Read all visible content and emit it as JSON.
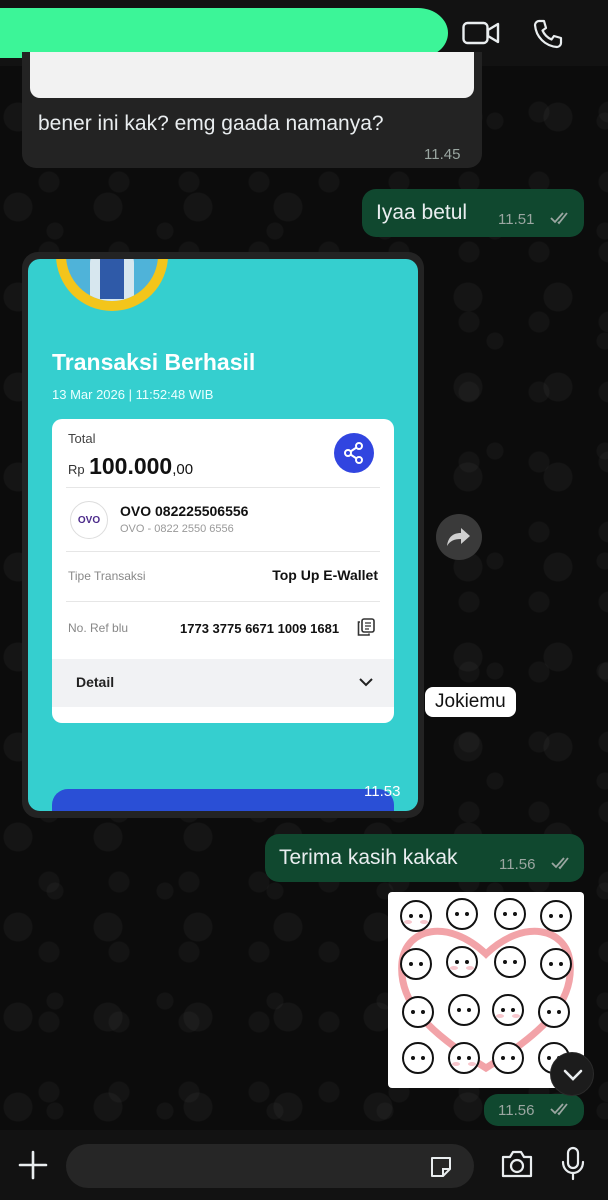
{
  "header": {
    "video_call_icon": "video-icon",
    "voice_call_icon": "phone-icon"
  },
  "messages": [
    {
      "direction": "in",
      "text": "bener ini kak? emg gaada namanya?",
      "time": "11.45"
    },
    {
      "direction": "out",
      "text": "Iyaa betul",
      "time": "11.51",
      "status": "read"
    },
    {
      "direction": "in",
      "type": "image",
      "time": "11.53"
    },
    {
      "direction": "out",
      "text": "Terima kasih kakak",
      "time": "11.56",
      "status": "read"
    },
    {
      "direction": "out",
      "type": "sticker",
      "time": "11.56",
      "status": "read"
    }
  ],
  "receipt": {
    "title": "Transaksi Berhasil",
    "date": "13 Mar 2026 | 11:52:48 WIB",
    "total_label": "Total",
    "currency": "Rp",
    "amount_main": "100.000",
    "amount_decimal": ",00",
    "recipient_logo": "OVO",
    "recipient_name": "OVO 082225506556",
    "recipient_sub": "OVO - 0822 2550 6556",
    "type_label": "Tipe Transaksi",
    "type_value": "Top Up E-Wallet",
    "ref_label": "No. Ref blu",
    "ref_value": "1773 3775 6671 1009 1681",
    "detail_label": "Detail"
  },
  "watermark_tag": "Jokiemu",
  "colors": {
    "incoming_bubble": "#232323",
    "outgoing_bubble": "#10482f",
    "redaction": "#3cf598",
    "receipt_bg": "#35cfcf",
    "share_button": "#3145e0"
  }
}
